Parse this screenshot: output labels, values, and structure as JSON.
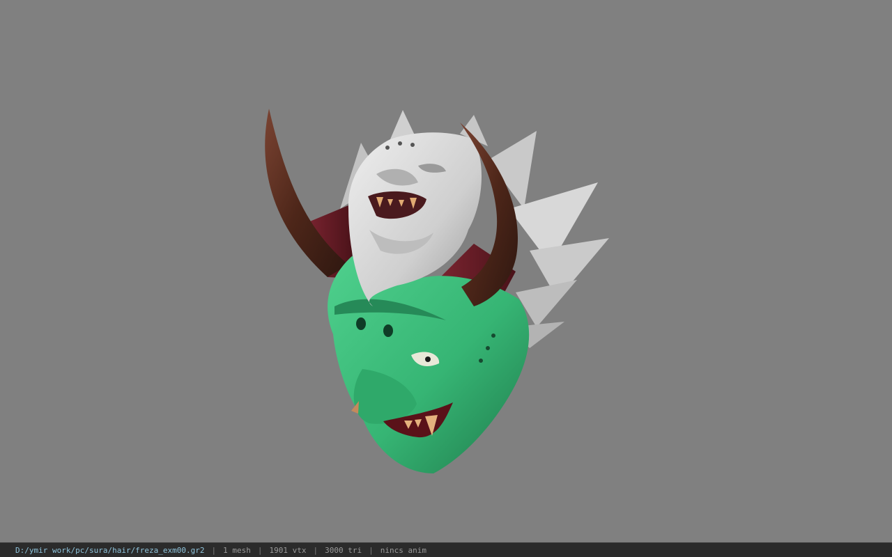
{
  "viewport": {
    "background": "#808080",
    "model": {
      "kind": "oni-demon-helmet-mesh",
      "colors": {
        "skin": "#37b877",
        "skin_dark": "#1f7f4e",
        "metal": "#d2d2d2",
        "metal_dark": "#9c9c9c",
        "horn": "#5a2f22",
        "horn_dark": "#3a1c14",
        "inner": "#6a1f28",
        "teeth": "#d9a776"
      }
    }
  },
  "status_bar": {
    "file_path": "D:/ymir work/pc/sura/hair/freza_exm00.gr2",
    "separator": "|",
    "mesh_count": "1 mesh",
    "vertex_count": "1901 vtx",
    "triangle_count": "3000 tri",
    "anim_status": "nincs anim",
    "path_color": "#8fc4dc",
    "background": "#2b2b2b"
  }
}
